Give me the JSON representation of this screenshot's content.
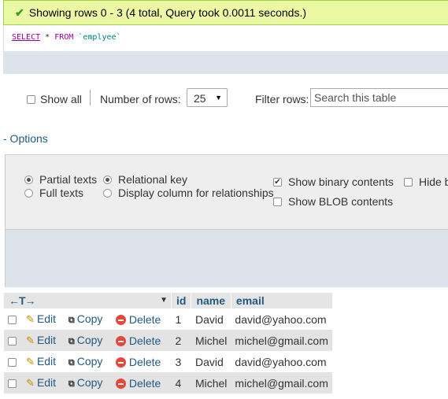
{
  "status": {
    "message": "Showing rows 0 - 3 (4 total, Query took 0.0011 seconds.)",
    "icon": "checkmark-icon",
    "color": "#ebf8a4"
  },
  "sql": {
    "select_kw": "SELECT",
    "star": "*",
    "from_kw": "FROM",
    "table": "`emplyee`"
  },
  "navigation": {
    "show_all_label": "Show all",
    "show_all_checked": false,
    "num_rows_label": "Number of rows:",
    "num_rows_value": "25",
    "filter_label": "Filter rows:",
    "filter_placeholder": "Search this table"
  },
  "options_link": "- Options",
  "options": {
    "partial_texts": "Partial texts",
    "full_texts": "Full texts",
    "relational_key": "Relational key",
    "display_column": "Display column for relationships",
    "show_binary": "Show binary contents",
    "show_blob": "Show BLOB contents",
    "hide_browser": "Hide b",
    "selected_text_mode": "Partial texts",
    "selected_relation_mode": "Relational key",
    "show_binary_checked": true,
    "show_blob_checked": false
  },
  "table": {
    "arrows_label": "←T→",
    "columns": [
      "id",
      "name",
      "email"
    ],
    "actions": {
      "edit": "Edit",
      "copy": "Copy",
      "delete": "Delete"
    },
    "rows": [
      {
        "id": "1",
        "name": "David",
        "email": "david@yahoo.com"
      },
      {
        "id": "2",
        "name": "Michel",
        "email": "michel@gmail.com"
      },
      {
        "id": "3",
        "name": "David",
        "email": "david@yahoo.com"
      },
      {
        "id": "4",
        "name": "Michel",
        "email": "michel@gmail.com"
      }
    ]
  }
}
